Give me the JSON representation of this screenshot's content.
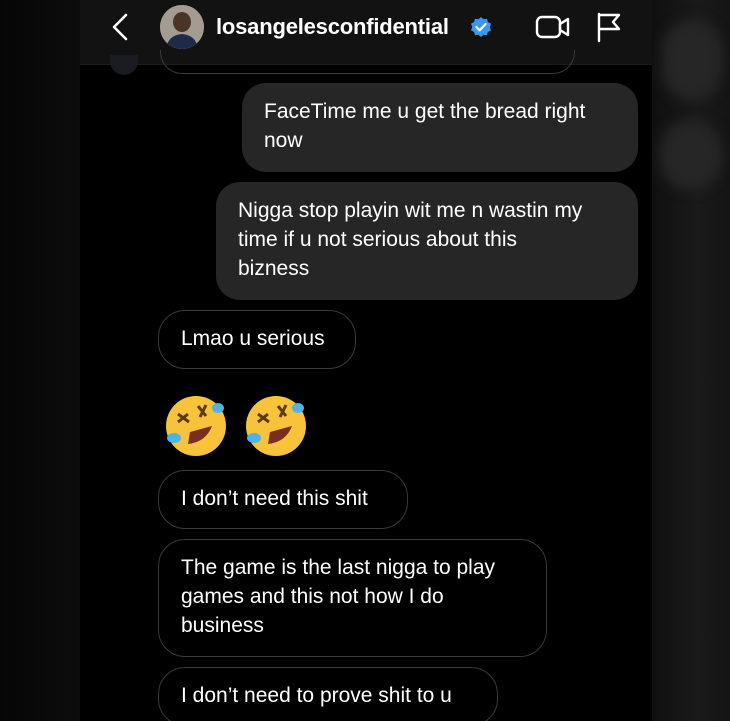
{
  "header": {
    "username": "losangelesconfidential",
    "verified": true
  },
  "icons": {
    "back": "chevron-left-icon",
    "verified": "verified-badge-icon",
    "video": "video-call-icon",
    "flag": "flag-icon",
    "emoji": "rolling-on-floor-laughing-emoji"
  },
  "colors": {
    "background": "#000000",
    "sent_bubble": "#262626",
    "received_border": "#3a3a3a",
    "verified_blue": "#3897f0",
    "text": "#ffffff"
  },
  "messages": [
    {
      "direction": "sent",
      "text": "FaceTime me u get the bread right\nnow"
    },
    {
      "direction": "sent",
      "text": "Nigga stop playin wit me n wastin my\ntime  if u not serious about this\nbizness"
    },
    {
      "direction": "received",
      "text": "Lmao u serious"
    },
    {
      "direction": "received",
      "type": "emoji",
      "text": "🤣🤣"
    },
    {
      "direction": "received",
      "text": "I don’t need this shit"
    },
    {
      "direction": "received",
      "text": "The game is the last nigga to play\ngames and this not how I do\nbusiness"
    },
    {
      "direction": "received",
      "text": "I don’t need to prove shit to u"
    }
  ]
}
